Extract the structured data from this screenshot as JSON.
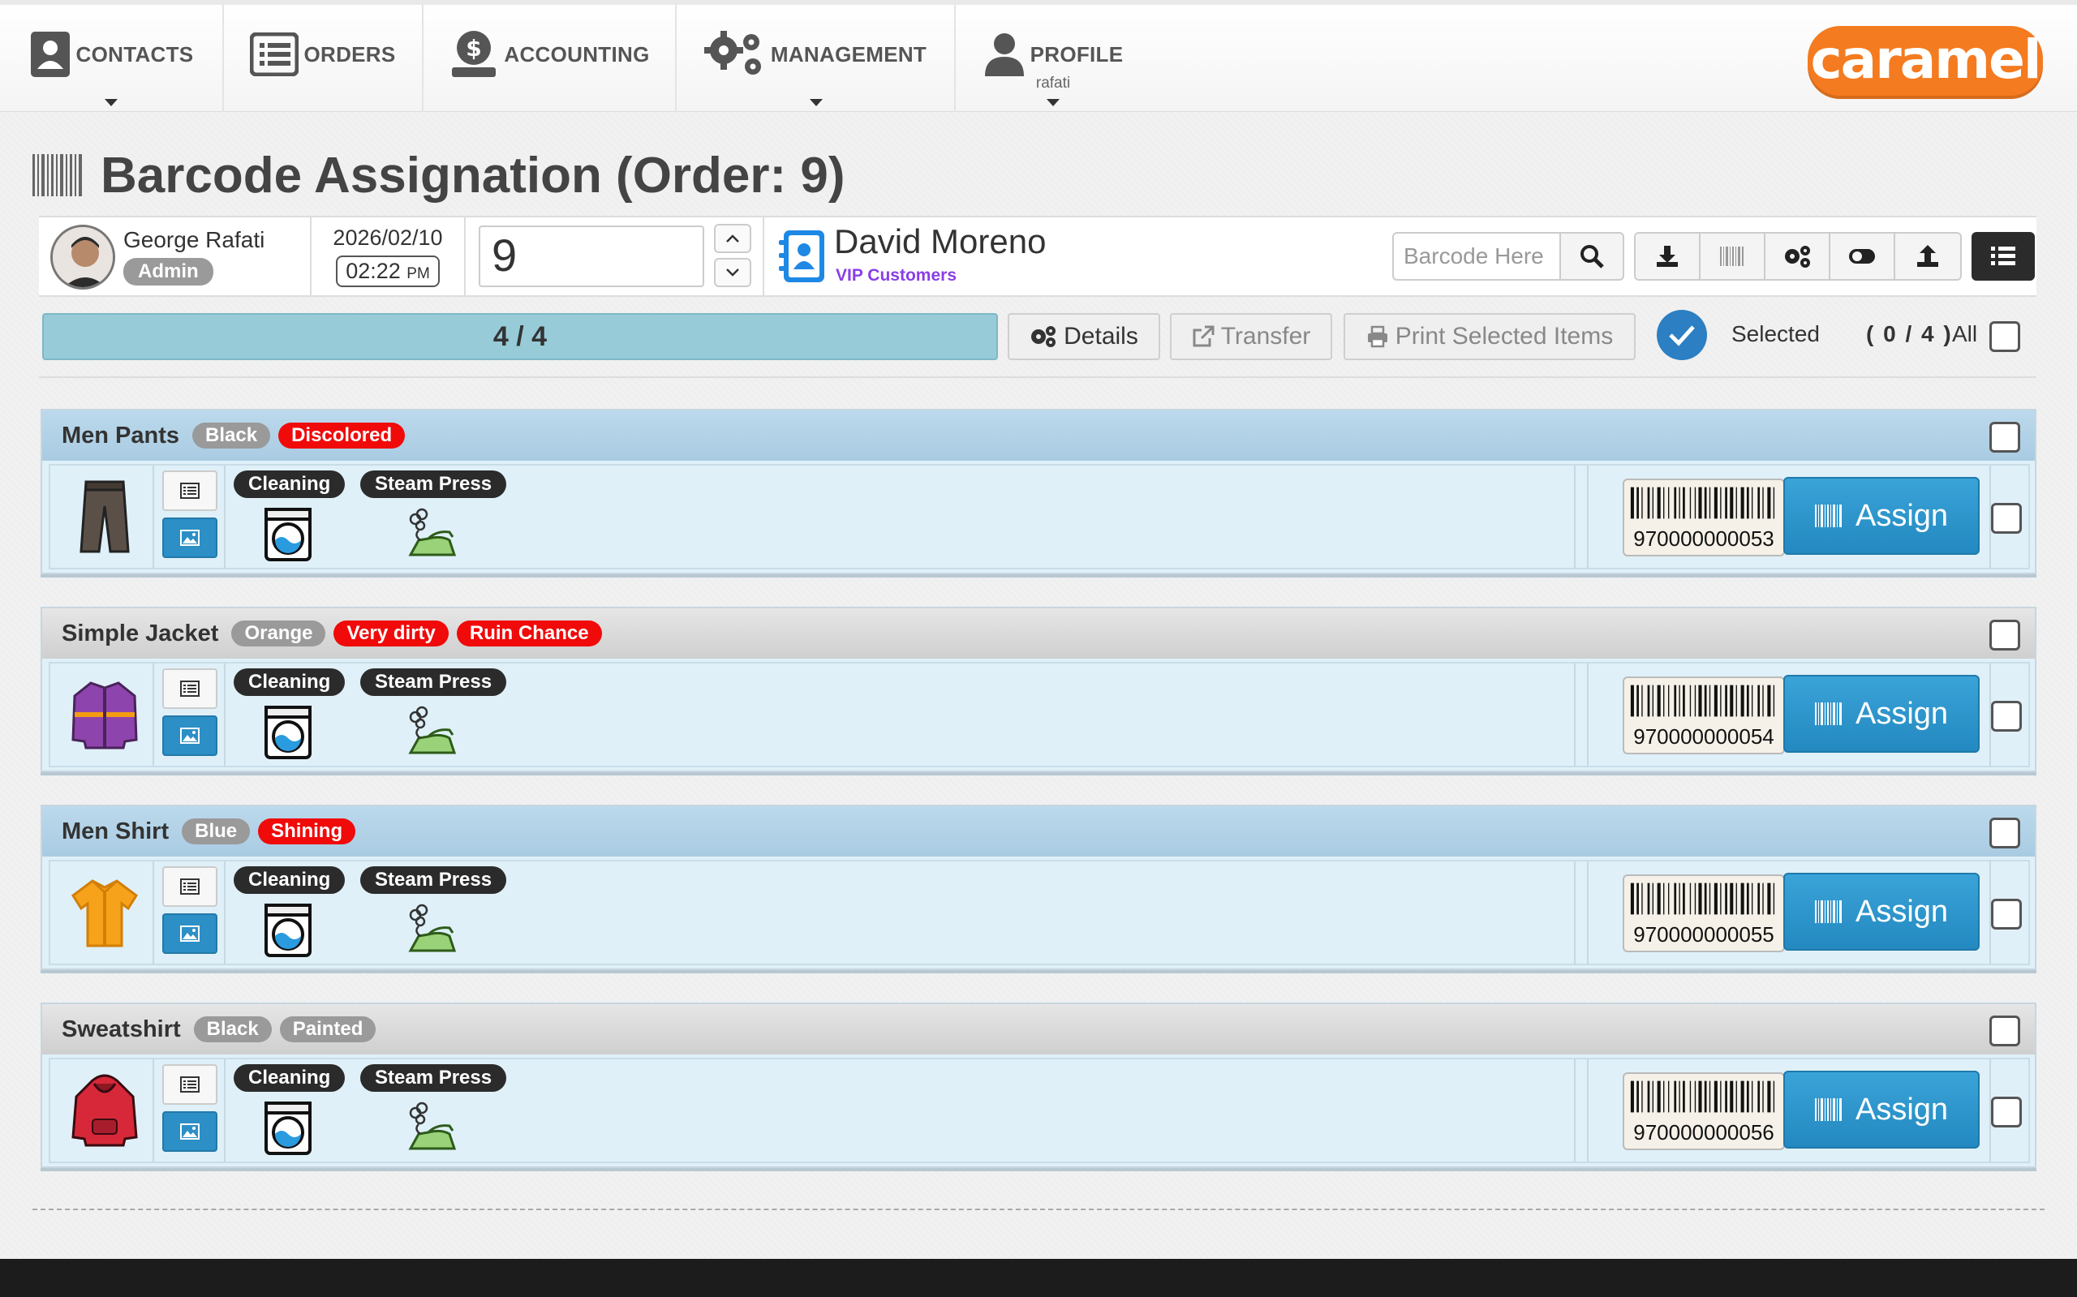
{
  "nav": {
    "contacts": "CONTACTS",
    "orders": "ORDERS",
    "accounting": "ACCOUNTING",
    "management": "MANAGEMENT",
    "profile": "PROFILE",
    "profile_user": "rafati",
    "logo": "caramel"
  },
  "page": {
    "title": "Barcode Assignation (Order: 9)"
  },
  "user": {
    "name": "George Rafati",
    "role": "Admin"
  },
  "datetime": {
    "date": "2026/02/10",
    "time": "02:22",
    "ampm": "PM"
  },
  "order": {
    "number": "9"
  },
  "client": {
    "name": "David Moreno",
    "group": "VIP Customers"
  },
  "search": {
    "placeholder": "Barcode Here"
  },
  "actions": {
    "progress": "4 / 4",
    "details": "Details",
    "transfer": "Transfer",
    "print": "Print Selected Items",
    "selected": "Selected",
    "count": "( 0 / 4 )",
    "all": "All"
  },
  "colors": {
    "accent": "#2b7fc2",
    "brand": "#f47b20",
    "danger": "#f00a0a",
    "assign": "#2a93c9"
  },
  "items": [
    {
      "name": "Men Pants",
      "tags": [
        {
          "text": "Black",
          "type": "gray"
        },
        {
          "text": "Discolored",
          "type": "red"
        }
      ],
      "services": [
        "Cleaning",
        "Steam Press"
      ],
      "barcode": "970000000053",
      "assign": "Assign",
      "icon": "pants-icon"
    },
    {
      "name": "Simple Jacket",
      "tags": [
        {
          "text": "Orange",
          "type": "gray"
        },
        {
          "text": "Very dirty",
          "type": "red"
        },
        {
          "text": "Ruin Chance",
          "type": "red"
        }
      ],
      "services": [
        "Cleaning",
        "Steam Press"
      ],
      "barcode": "970000000054",
      "assign": "Assign",
      "icon": "jacket-icon"
    },
    {
      "name": "Men Shirt",
      "tags": [
        {
          "text": "Blue",
          "type": "gray"
        },
        {
          "text": "Shining",
          "type": "red"
        }
      ],
      "services": [
        "Cleaning",
        "Steam Press"
      ],
      "barcode": "970000000055",
      "assign": "Assign",
      "icon": "shirt-icon"
    },
    {
      "name": "Sweatshirt",
      "tags": [
        {
          "text": "Black",
          "type": "gray"
        },
        {
          "text": "Painted",
          "type": "gray"
        }
      ],
      "services": [
        "Cleaning",
        "Steam Press"
      ],
      "barcode": "970000000056",
      "assign": "Assign",
      "icon": "hoodie-icon"
    }
  ]
}
